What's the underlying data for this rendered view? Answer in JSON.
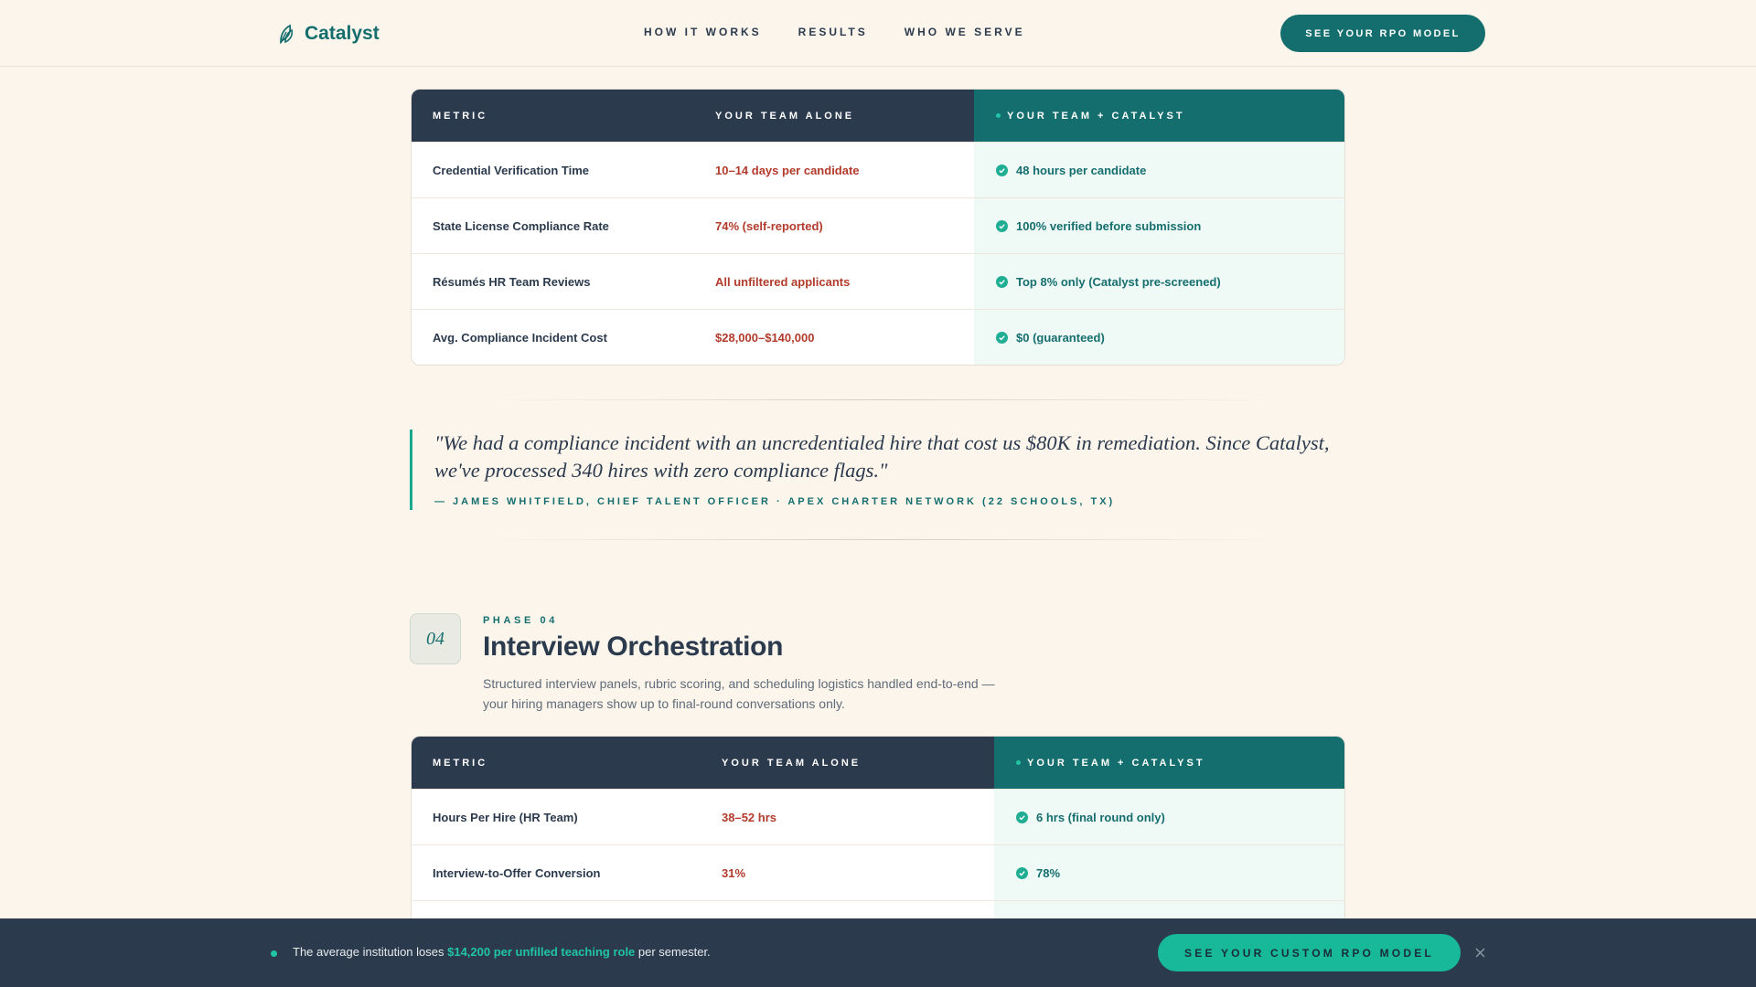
{
  "header": {
    "brand": "Catalyst",
    "nav": [
      "HOW IT WORKS",
      "RESULTS",
      "WHO WE SERVE"
    ],
    "cta": "SEE YOUR RPO MODEL"
  },
  "table1": {
    "headers": [
      "METRIC",
      "YOUR TEAM ALONE",
      "YOUR TEAM + CATALYST"
    ],
    "rows": [
      [
        "Credential Verification Time",
        "10–14 days per candidate",
        "48 hours per candidate"
      ],
      [
        "State License Compliance Rate",
        "74% (self-reported)",
        "100% verified before submission"
      ],
      [
        "Résumés HR Team Reviews",
        "All unfiltered applicants",
        "Top 8% only (Catalyst pre-screened)"
      ],
      [
        "Avg. Compliance Incident Cost",
        "$28,000–$140,000",
        "$0 (guaranteed)"
      ]
    ]
  },
  "quote": {
    "text": "\"We had a compliance incident with an uncredentialed hire that cost us $80K in remediation. Since Catalyst, we've processed 340 hires with zero compliance flags.\"",
    "attribution": "— JAMES WHITFIELD, CHIEF TALENT OFFICER · APEX CHARTER NETWORK (22 SCHOOLS, TX)"
  },
  "phase": {
    "number": "04",
    "eyebrow": "PHASE 04",
    "title": "Interview Orchestration",
    "description": "Structured interview panels, rubric scoring, and scheduling logistics handled end-to-end — your hiring managers show up to final-round conversations only."
  },
  "table2": {
    "headers": [
      "METRIC",
      "YOUR TEAM ALONE",
      "YOUR TEAM + CATALYST"
    ],
    "rows": [
      [
        "Hours Per Hire (HR Team)",
        "38–52 hrs",
        "6 hrs (final round only)"
      ],
      [
        "Interview-to-Offer Conversion",
        "31%",
        "78%"
      ]
    ]
  },
  "bottom_bar": {
    "text_before": "The average institution loses ",
    "highlight": "$14,200 per unfilled teaching role",
    "text_after": " per semester.",
    "cta": "SEE YOUR CUSTOM RPO MODEL"
  },
  "colors": {
    "background": "#fcf5ec",
    "navy": "#2b3a4d",
    "teal": "#156e6e",
    "accent": "#21c4a5",
    "negative": "#b23b2b"
  },
  "icons": [
    "leaf-logo-icon",
    "check-circle-icon",
    "close-icon"
  ]
}
